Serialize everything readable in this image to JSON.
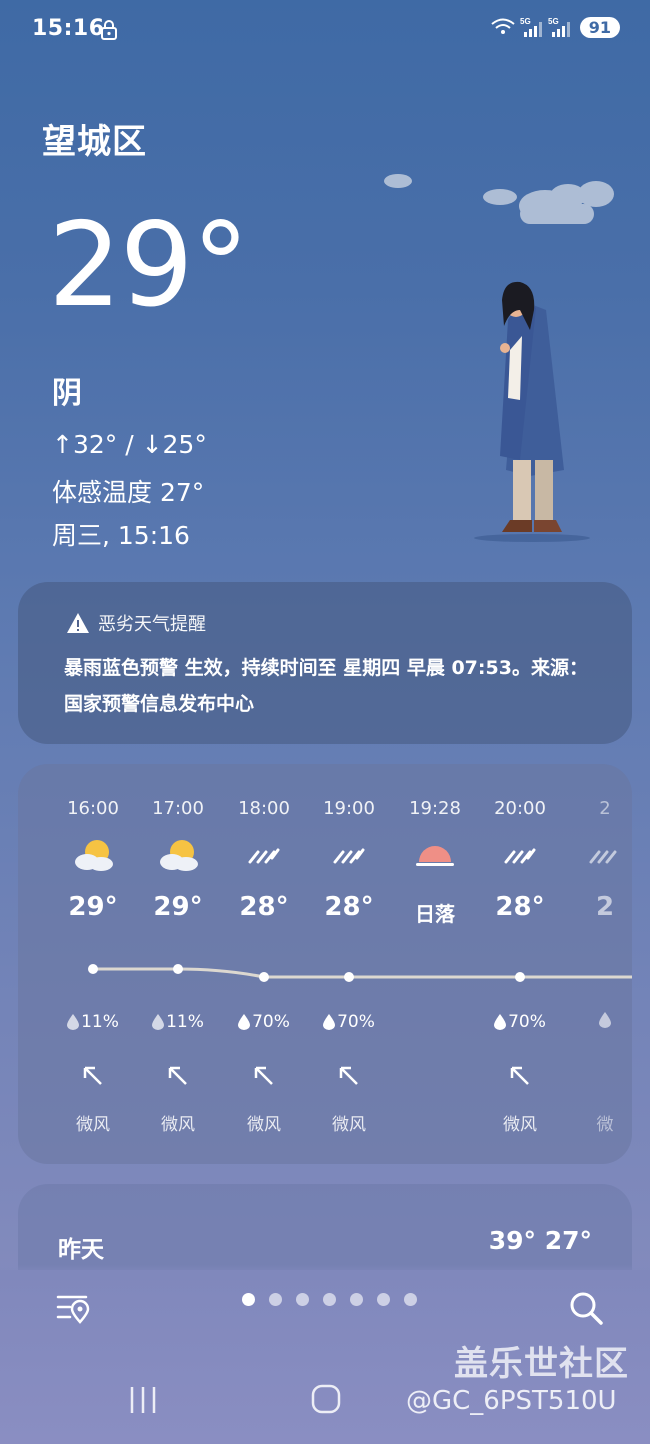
{
  "status_bar": {
    "time": "15:16",
    "battery": "91"
  },
  "current": {
    "location": "望城区",
    "temperature": "29°",
    "condition": "阴",
    "high_low": "↑32° / ↓25°",
    "feels_like": "体感温度 27°",
    "datetime": "周三, 15:16"
  },
  "alert": {
    "title": "恶劣天气提醒",
    "icon": "warning-icon",
    "text": "暴雨蓝色预警 生效，持续时间至 星期四 早晨 07:53。来源：国家预警信息发布中心"
  },
  "hourly": [
    {
      "time": "16:00",
      "icon": "sun-cloud-icon",
      "temp": "29°",
      "precip": "11%",
      "wind": "微风"
    },
    {
      "time": "17:00",
      "icon": "sun-cloud-icon",
      "temp": "29°",
      "precip": "11%",
      "wind": "微风"
    },
    {
      "time": "18:00",
      "icon": "rain-icon",
      "temp": "28°",
      "precip": "70%",
      "wind": "微风"
    },
    {
      "time": "19:00",
      "icon": "rain-icon",
      "temp": "28°",
      "precip": "70%",
      "wind": "微风"
    },
    {
      "time": "19:28",
      "icon": "sunset-icon",
      "label": "日落"
    },
    {
      "time": "20:00",
      "icon": "rain-icon",
      "temp": "28°",
      "precip": "70%",
      "wind": "微风"
    },
    {
      "time": "2",
      "icon": "rain-icon",
      "temp": "2",
      "precip": "",
      "wind": "微"
    }
  ],
  "yesterday": {
    "label": "昨天",
    "temps": "39° 27°"
  },
  "bottom_bar": {
    "page_count": 7,
    "active_page": 0
  },
  "watermark": {
    "line1": "盖乐世社区",
    "line2": "@GC_6PST510U"
  },
  "colors": {
    "background_top": "#3f6aa5",
    "background_bottom": "#8c8fc0",
    "sun": "#f6c343",
    "sunset": "#ef8f86"
  }
}
